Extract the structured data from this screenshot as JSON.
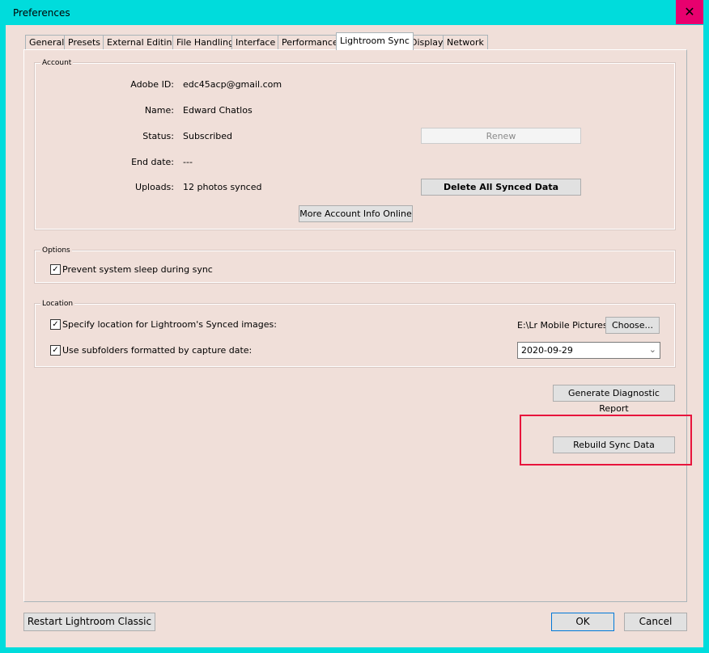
{
  "window": {
    "title": "Preferences",
    "close_icon": "close-x"
  },
  "tabs": [
    {
      "label": "General"
    },
    {
      "label": "Presets"
    },
    {
      "label": "External Editing"
    },
    {
      "label": "File Handling"
    },
    {
      "label": "Interface"
    },
    {
      "label": "Performance"
    },
    {
      "label": "Lightroom Sync",
      "active": true
    },
    {
      "label": "Display"
    },
    {
      "label": "Network"
    }
  ],
  "account": {
    "title": "Account",
    "adobe_id_label": "Adobe ID:",
    "adobe_id": "edc45acp@gmail.com",
    "name_label": "Name:",
    "name": "Edward Chatlos",
    "status_label": "Status:",
    "status": "Subscribed",
    "end_label": "End date:",
    "end": "---",
    "uploads_label": "Uploads:",
    "uploads": "12 photos synced",
    "renew": "Renew",
    "delete": "Delete All Synced Data",
    "more": "More Account Info Online"
  },
  "options": {
    "title": "Options",
    "prevent_sleep": "Prevent system sleep during sync",
    "prevent_sleep_checked": true
  },
  "location": {
    "title": "Location",
    "specify": "Specify location for Lightroom's Synced images:",
    "specify_checked": true,
    "path": "E:\\Lr Mobile Pictures",
    "choose": "Choose...",
    "subfolders": "Use subfolders formatted by capture date:",
    "subfolders_checked": true,
    "date_format": "2020-09-29"
  },
  "diagnostic": "Generate Diagnostic Report",
  "rebuild": "Rebuild Sync Data",
  "highlight_color": "#e8143c",
  "footer": {
    "restart": "Restart Lightroom Classic",
    "ok": "OK",
    "cancel": "Cancel"
  }
}
